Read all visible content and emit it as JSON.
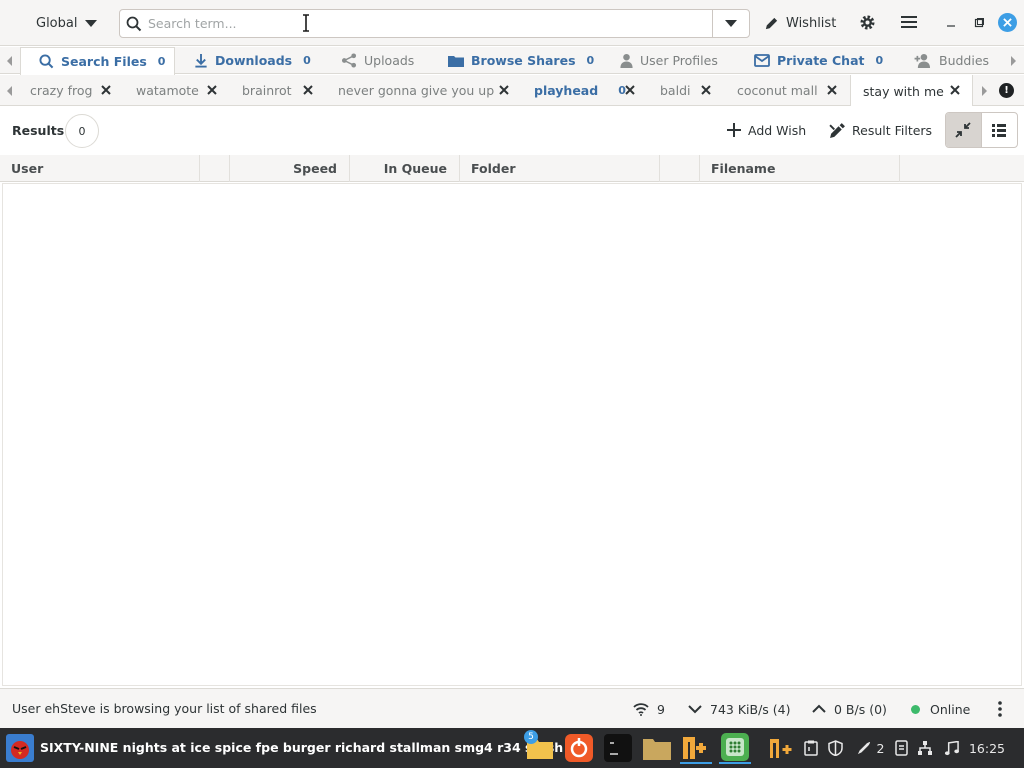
{
  "header": {
    "scope": "Global",
    "search_placeholder": "Search term...",
    "wishlist_label": "Wishlist"
  },
  "main_tabs": [
    {
      "label": "Search Files",
      "count": "0",
      "bold": true,
      "active": true,
      "icon": "search-icon"
    },
    {
      "label": "Downloads",
      "count": "0",
      "bold": true,
      "icon": "download-icon"
    },
    {
      "label": "Uploads",
      "count": "",
      "bold": false,
      "icon": "share-icon"
    },
    {
      "label": "Browse Shares",
      "count": "0",
      "bold": true,
      "icon": "folder-icon"
    },
    {
      "label": "User Profiles",
      "count": "",
      "bold": false,
      "icon": "user-icon"
    },
    {
      "label": "Private Chat",
      "count": "0",
      "bold": true,
      "icon": "mail-icon"
    },
    {
      "label": "Buddies",
      "count": "",
      "bold": false,
      "icon": "add-user-icon"
    }
  ],
  "search_tabs": [
    {
      "label": "crazy frog"
    },
    {
      "label": "watamote"
    },
    {
      "label": "brainrot"
    },
    {
      "label": "never gonna give you up"
    },
    {
      "label": "playhead",
      "count": "0",
      "bold": true
    },
    {
      "label": "baldi"
    },
    {
      "label": "coconut mall"
    },
    {
      "label": "stay with me",
      "active": true
    }
  ],
  "results": {
    "label": "Results",
    "count": "0",
    "add_wish_label": "Add Wish",
    "result_filters_label": "Result Filters"
  },
  "columns": [
    "User",
    "Speed",
    "In Queue",
    "Folder",
    "Filename"
  ],
  "status": {
    "message": "User ehSteve is browsing your list of shared files",
    "connections": "9",
    "download_speed": "743 KiB/s (4)",
    "upload_speed": "0 B/s (0)",
    "online_label": "Online",
    "online_color": "#3dba6b"
  },
  "taskbar": {
    "window_title": "SIXTY-NINE nights at ice spice fpe burger richard stallman smg4 r34 stash",
    "files_badge": "5",
    "tray_count": "2",
    "clock": "16:25",
    "accent": "#3d9ee5"
  }
}
